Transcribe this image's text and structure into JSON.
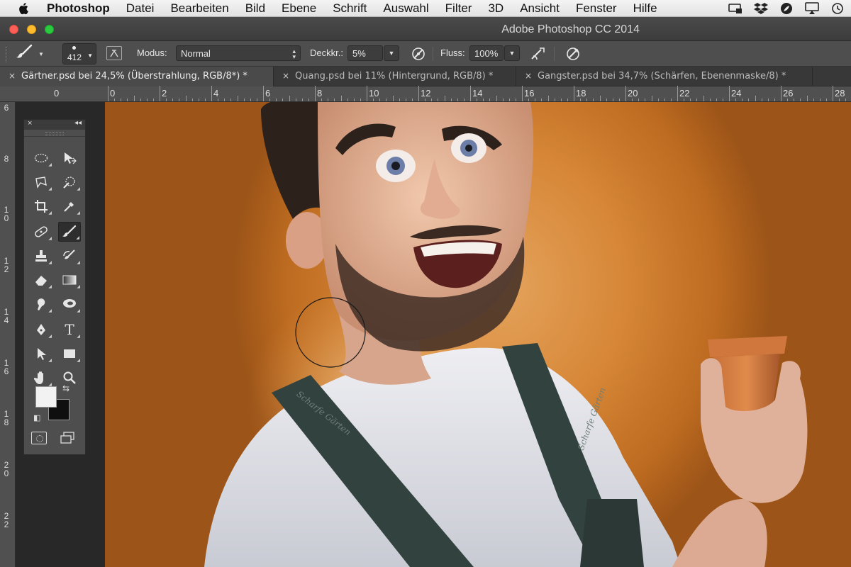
{
  "menubar": {
    "items": [
      "Photoshop",
      "Datei",
      "Bearbeiten",
      "Bild",
      "Ebene",
      "Schrift",
      "Auswahl",
      "Filter",
      "3D",
      "Ansicht",
      "Fenster",
      "Hilfe"
    ],
    "status_icons": [
      "display-icon",
      "dropbox-icon",
      "leaf-icon",
      "airplay-icon",
      "time-machine-icon"
    ]
  },
  "window": {
    "title": "Adobe Photoshop CC 2014"
  },
  "options": {
    "brush_size": "412",
    "modus_label": "Modus:",
    "modus_value": "Normal",
    "deckkraft_label": "Deckkr.:",
    "deckkraft_value": "5%",
    "fluss_label": "Fluss:",
    "fluss_value": "100%"
  },
  "tabs": [
    {
      "label": "Gärtner.psd bei 24,5% (Überstrahlung, RGB/8*) *",
      "active": true
    },
    {
      "label": "Quang.psd bei 11% (Hintergrund, RGB/8) *",
      "active": false
    },
    {
      "label": "Gangster.psd bei 34,7% (Schärfen, Ebenenmaske/8) *",
      "active": false
    }
  ],
  "ruler": {
    "corner_label": "0",
    "top": [
      "0",
      "2",
      "4",
      "6",
      "8",
      "10",
      "12",
      "14",
      "16",
      "18",
      "20",
      "22",
      "24",
      "26",
      "28"
    ],
    "left": [
      "6",
      "8",
      "10",
      "12",
      "14",
      "16",
      "18",
      "20",
      "22"
    ]
  },
  "tools": {
    "foreground_color": "#f2f2f2",
    "background_color": "#0f0f0f"
  },
  "apron_text": [
    "Scharfe Gärten",
    "Scharfe Gärten"
  ]
}
